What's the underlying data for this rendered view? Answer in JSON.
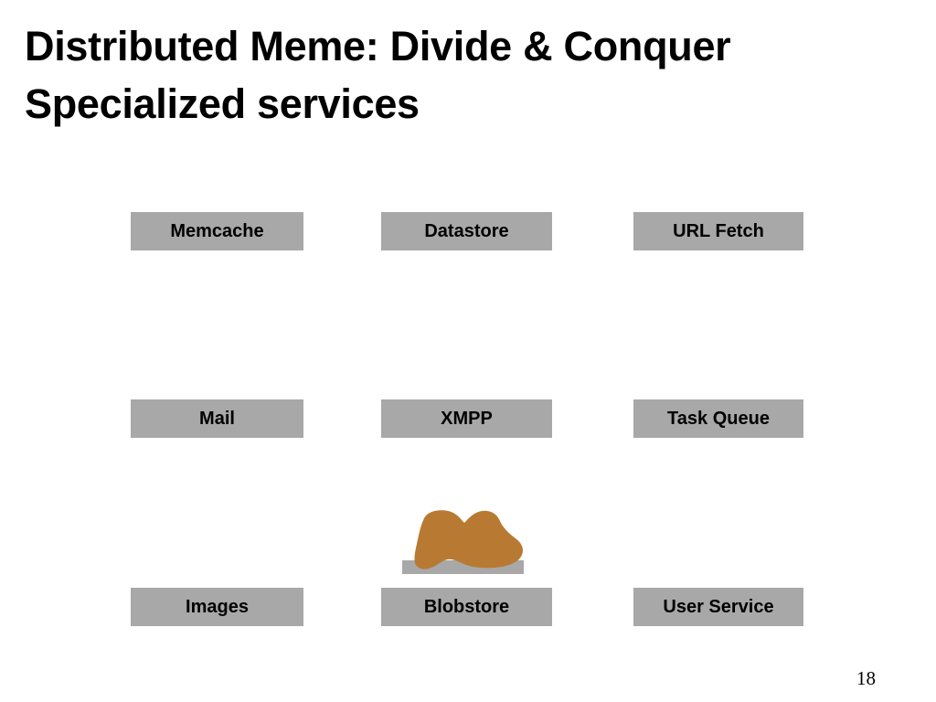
{
  "slide": {
    "background_color": "#ffffff",
    "title": {
      "line1": "Distributed Meme: Divide & Conquer",
      "line2": "Specialized services"
    },
    "page_number": "18"
  },
  "colors": {
    "box_fill": "#a8a8a8",
    "box_text": "#000000",
    "blob_fill": "#b87a32",
    "blob_base": "#a8a8a8",
    "title_text": "#000000"
  },
  "service_grid": {
    "rows": [
      {
        "cells": [
          {
            "label": "Memcache"
          },
          {
            "label": "Datastore"
          },
          {
            "label": "URL Fetch"
          }
        ]
      },
      {
        "cells": [
          {
            "label": "Mail"
          },
          {
            "label": "XMPP"
          },
          {
            "label": "Task Queue"
          }
        ]
      },
      {
        "cells": [
          {
            "label": "Images"
          },
          {
            "label": "Blobstore"
          },
          {
            "label": "User Service"
          }
        ]
      }
    ]
  },
  "illustration": {
    "name": "blob-shape",
    "description": "Brown organic blob resting on a grey bar, above the Blobstore box"
  }
}
